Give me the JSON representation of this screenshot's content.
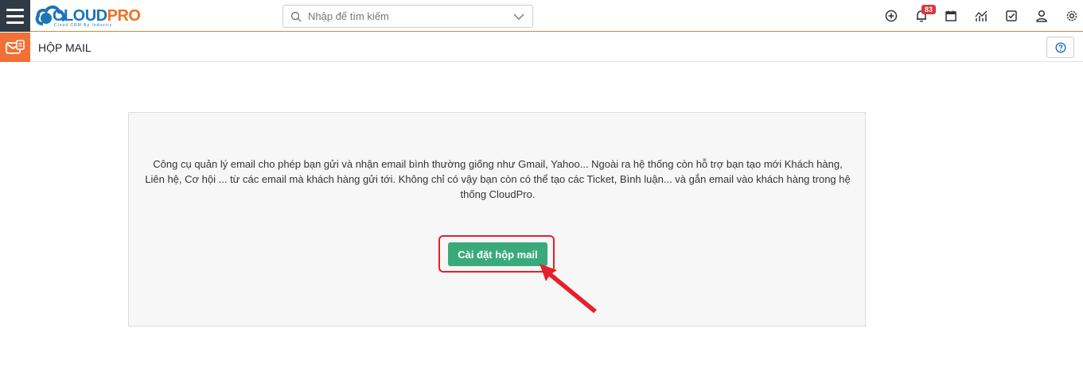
{
  "header": {
    "logo": {
      "part1": "CLOUD",
      "part2": "PRO",
      "tagline": "Cloud CRM By Industry"
    },
    "search": {
      "placeholder": "Nhập để tìm kiếm"
    },
    "notifications_count": "83",
    "icons": [
      "plus-circle-icon",
      "bell-icon",
      "calendar-icon",
      "chart-icon",
      "check-square-icon",
      "user-icon",
      "gear-icon"
    ]
  },
  "module": {
    "title": "HỘP MAIL",
    "icon": "mailbox-icon"
  },
  "content": {
    "description": "Công cụ quản lý email cho phép bạn gửi và nhận email bình thường giống như Gmail, Yahoo... Ngoài ra hệ thống còn hỗ trợ bạn tạo mới Khách hàng, Liên hệ, Cơ hội ... từ các email mà khách hàng gửi tới. Không chỉ có vậy bạn còn có thể tạo các Ticket, Bình luận... và gắn email vào khách hàng trong hệ thống CloudPro.",
    "setup_button": "Cài đặt hộp mail"
  },
  "colors": {
    "accent_orange": "#f26f36",
    "sidebar_dark": "#2f3a45",
    "button_green": "#3aaa7a",
    "highlight_red": "#e5202b",
    "badge_red": "#d9363e"
  }
}
